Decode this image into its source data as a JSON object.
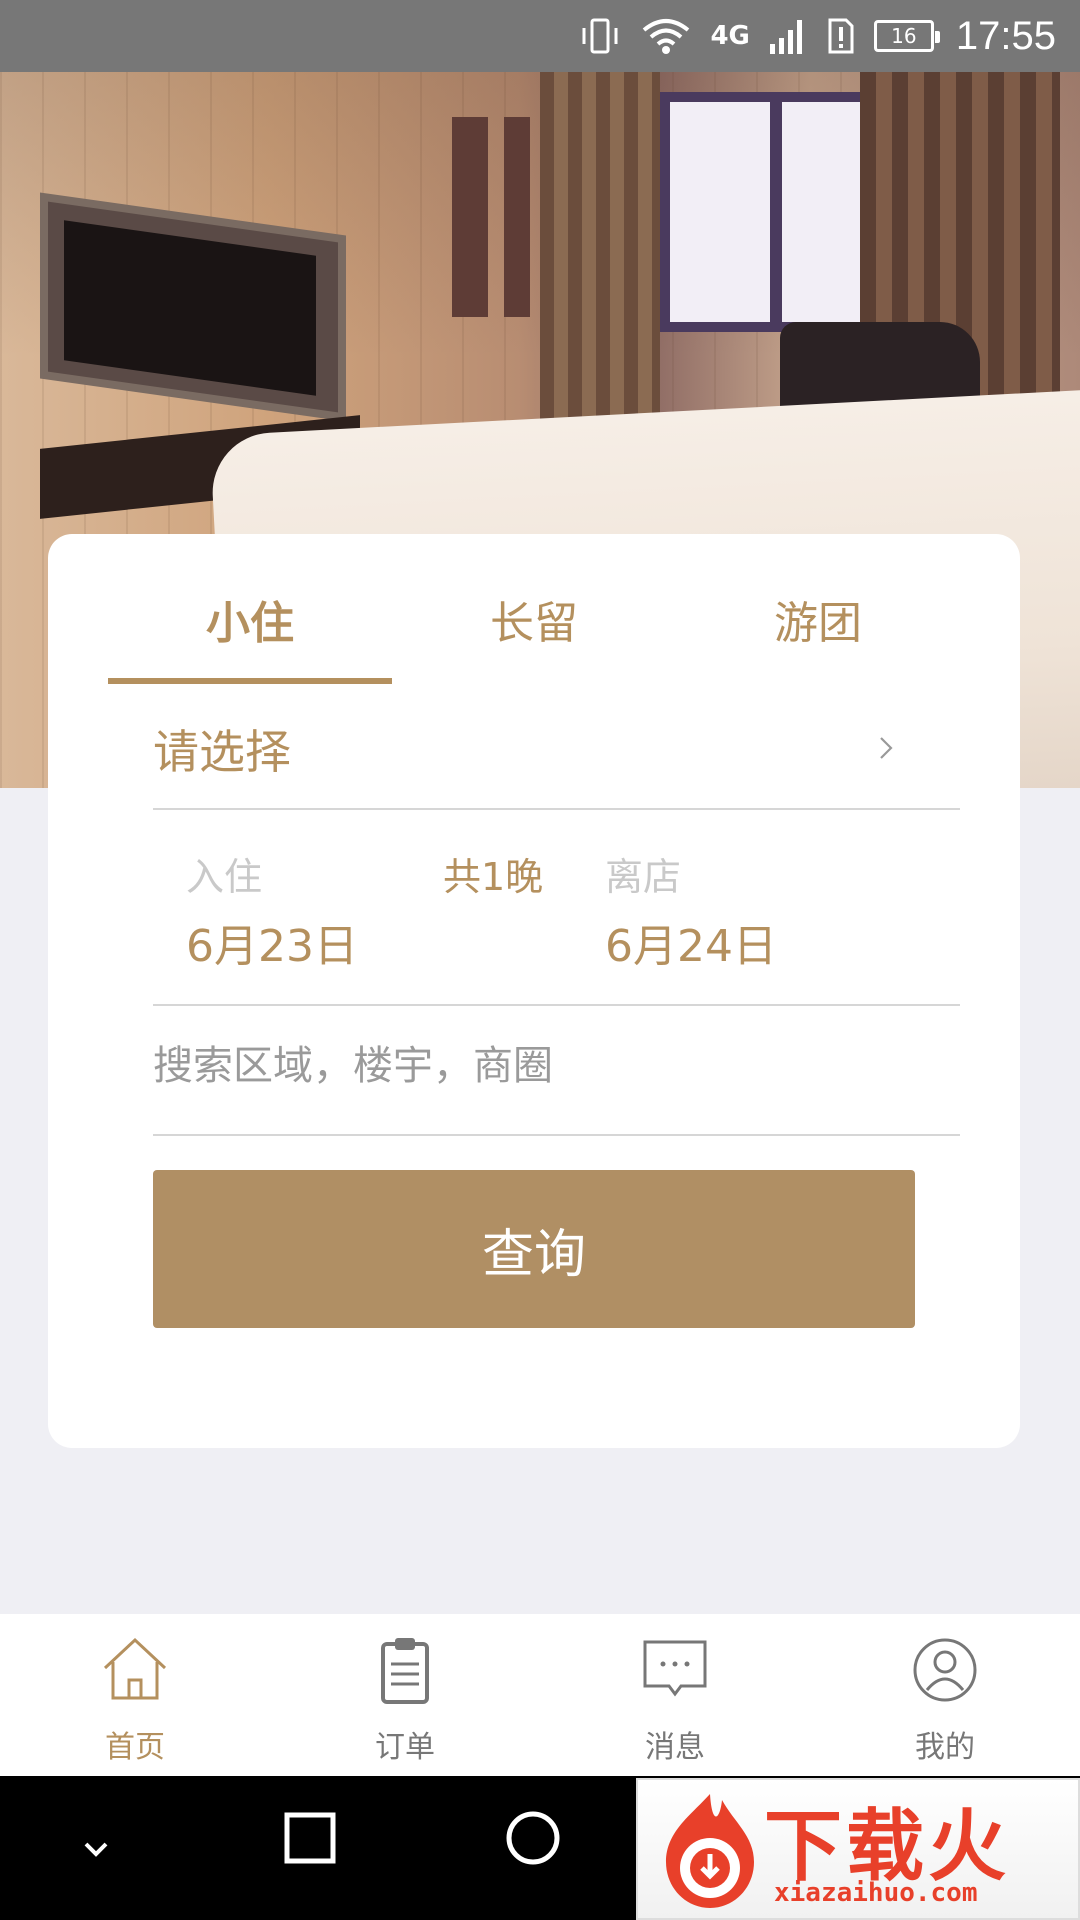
{
  "status_bar": {
    "network": "4G",
    "battery": "16",
    "time": "17:55"
  },
  "hero": {
    "image_subject": "hotel-room-photo"
  },
  "tabs": [
    {
      "label": "小住",
      "active": true
    },
    {
      "label": "长留",
      "active": false
    },
    {
      "label": "游团",
      "active": false
    }
  ],
  "select_row": {
    "label": "请选择"
  },
  "dates": {
    "checkin_label": "入住",
    "checkin_value": "6月23日",
    "nights": "共1晚",
    "checkout_label": "离店",
    "checkout_value": "6月24日"
  },
  "search": {
    "placeholder": "搜索区域，楼宇，商圈"
  },
  "query_button": {
    "label": "查询"
  },
  "bottom_tabs": [
    {
      "label": "首页",
      "icon": "home-icon",
      "active": true
    },
    {
      "label": "订单",
      "icon": "clipboard-icon",
      "active": false
    },
    {
      "label": "消息",
      "icon": "message-icon",
      "active": false
    },
    {
      "label": "我的",
      "icon": "profile-icon",
      "active": false
    }
  ],
  "colors": {
    "accent": "#b4905e",
    "button": "#b08f64",
    "background": "#efeff4"
  },
  "watermark": {
    "title": "下载火",
    "url": "xiazaihuo.com"
  }
}
